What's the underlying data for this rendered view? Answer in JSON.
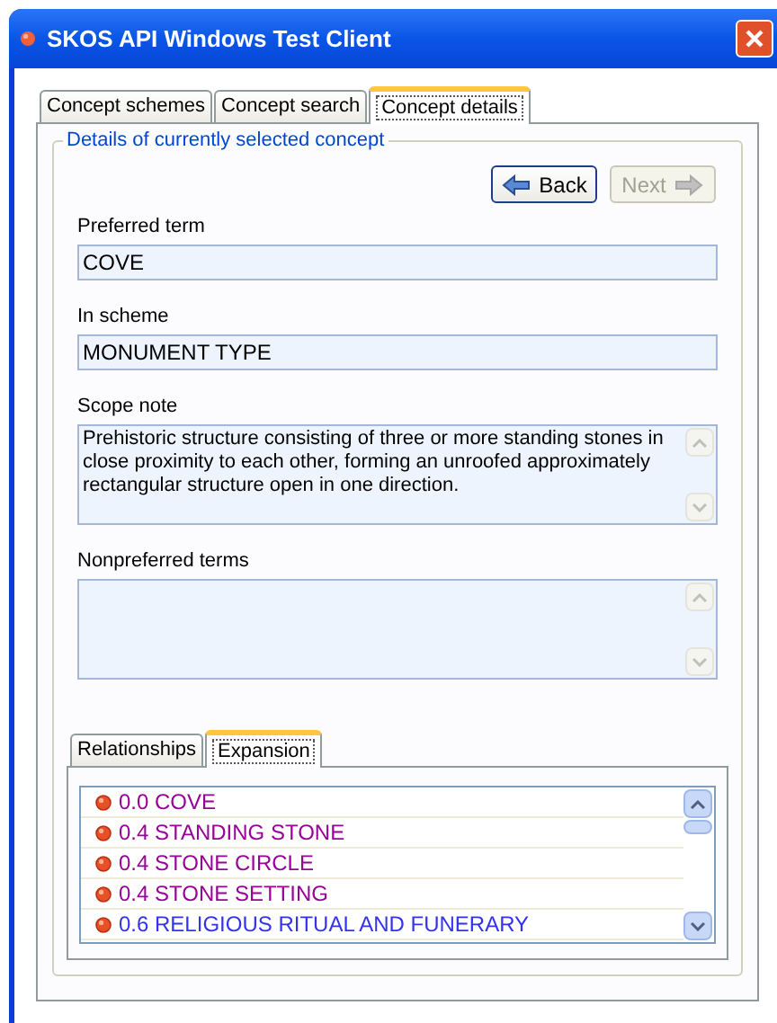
{
  "window": {
    "title": "SKOS API Windows Test Client"
  },
  "tabs": [
    {
      "label": "Concept schemes",
      "selected": false
    },
    {
      "label": "Concept search",
      "selected": false
    },
    {
      "label": "Concept details",
      "selected": true
    }
  ],
  "group": {
    "title": "Details of currently selected concept"
  },
  "nav": [
    {
      "label": "Back",
      "disabled": false
    },
    {
      "label": "Next",
      "disabled": true
    }
  ],
  "fields": [
    {
      "label": "Preferred term",
      "value": "COVE",
      "kind": "line"
    },
    {
      "label": "In scheme",
      "value": "MONUMENT TYPE",
      "kind": "line"
    },
    {
      "label": "Scope note",
      "value": "Prehistoric structure consisting of three or more standing stones in close proximity to each other, forming an unroofed approximately rectangular structure open in one direction.",
      "kind": "multiline"
    },
    {
      "label": "Nonpreferred terms",
      "kind": "multiline"
    }
  ],
  "subtabs": [
    {
      "label": "Relationships",
      "selected": false
    },
    {
      "label": "Expansion",
      "selected": true
    }
  ],
  "expansion": [
    {
      "label": "0.0 COVE",
      "color": "#990099"
    },
    {
      "label": "0.4 STANDING STONE",
      "color": "#990099"
    },
    {
      "label": "0.4 STONE CIRCLE",
      "color": "#990099"
    },
    {
      "label": "0.4 STONE SETTING",
      "color": "#990099"
    },
    {
      "label": "0.6 RELIGIOUS RITUAL AND FUNERARY",
      "color": "#3333ee"
    }
  ]
}
